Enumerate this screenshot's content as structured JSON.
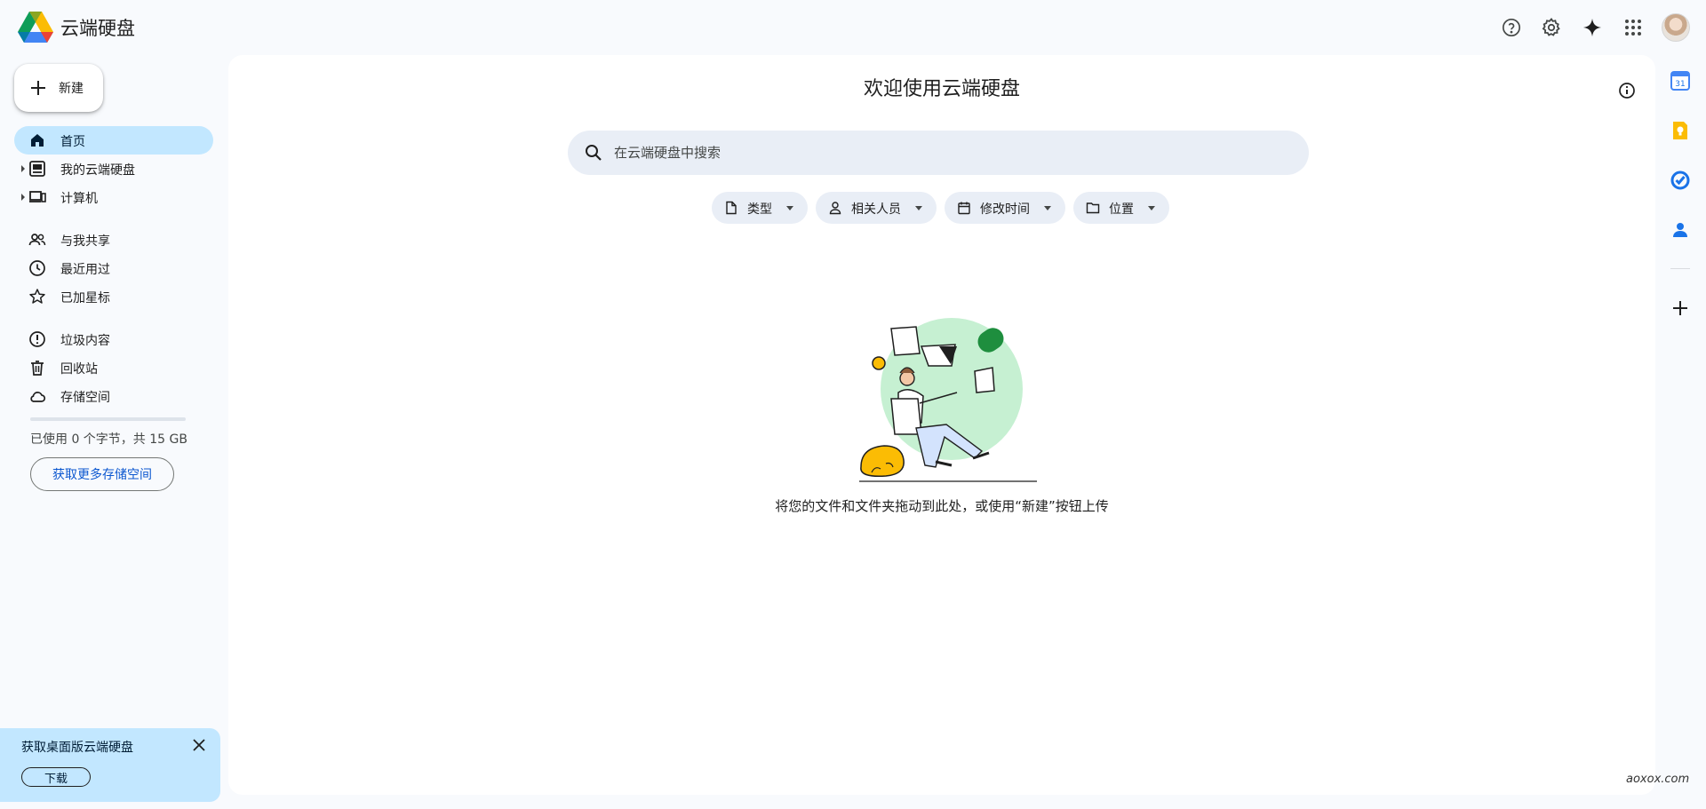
{
  "app": {
    "title": "云端硬盘"
  },
  "topbar": {
    "icons": [
      "help-icon",
      "settings-icon",
      "gemini-sparkle-icon",
      "apps-grid-icon"
    ]
  },
  "sidebar": {
    "new_label": "新建",
    "items": [
      {
        "label": "首页",
        "icon": "home-icon",
        "active": true
      },
      {
        "label": "我的云端硬盘",
        "icon": "my-drive-icon",
        "expandable": true
      },
      {
        "label": "计算机",
        "icon": "computer-icon",
        "expandable": true
      },
      {
        "label": "与我共享",
        "icon": "shared-people-icon"
      },
      {
        "label": "最近用过",
        "icon": "clock-icon"
      },
      {
        "label": "已加星标",
        "icon": "star-icon"
      },
      {
        "label": "垃圾内容",
        "icon": "spam-icon"
      },
      {
        "label": "回收站",
        "icon": "trash-icon"
      },
      {
        "label": "存储空间",
        "icon": "cloud-icon"
      }
    ],
    "storage_used_fraction": 0.0,
    "storage_text": "已使用 0 个字节，共 15 GB",
    "storage_button": "获取更多存储空间"
  },
  "promo": {
    "title": "获取桌面版云端硬盘",
    "button": "下载"
  },
  "main": {
    "title": "欢迎使用云端硬盘",
    "search_placeholder": "在云端硬盘中搜索",
    "filters": [
      {
        "label": "类型",
        "icon": "file-icon"
      },
      {
        "label": "相关人员",
        "icon": "person-icon"
      },
      {
        "label": "修改时间",
        "icon": "calendar-icon"
      },
      {
        "label": "位置",
        "icon": "folder-icon"
      }
    ],
    "empty_message": "将您的文件和文件夹拖动到此处，或使用“新建”按钮上传"
  },
  "watermark": "aoxox.com",
  "side_panel": {
    "apps": [
      "calendar-app-icon",
      "keep-app-icon",
      "tasks-app-icon",
      "contacts-app-icon",
      "add-addon-icon"
    ],
    "calendar_day": "31"
  },
  "colors": {
    "active_nav": "#c2e7ff",
    "accent": "#0b57d0",
    "chip_bg": "#e9eef6",
    "page_bg": "#f8fafd"
  }
}
